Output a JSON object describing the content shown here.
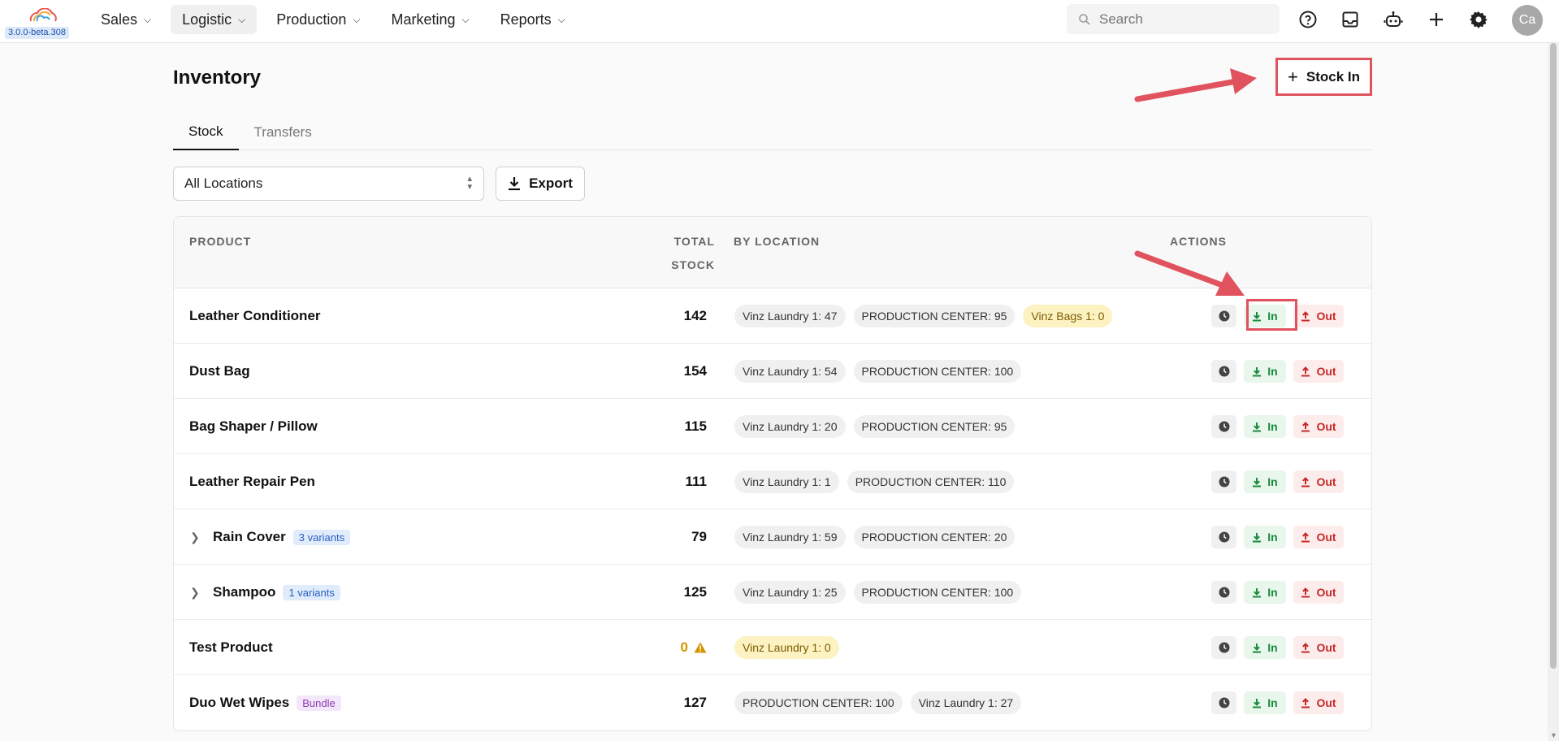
{
  "app": {
    "version": "3.0.0-beta.308",
    "avatar_initials": "Ca"
  },
  "nav": [
    {
      "label": "Sales",
      "active": false
    },
    {
      "label": "Logistic",
      "active": true
    },
    {
      "label": "Production",
      "active": false
    },
    {
      "label": "Marketing",
      "active": false
    },
    {
      "label": "Reports",
      "active": false
    }
  ],
  "search": {
    "placeholder": "Search"
  },
  "topbar_icons": [
    "help-icon",
    "inbox-icon",
    "robot-icon",
    "plus-icon",
    "gear-icon"
  ],
  "page": {
    "title": "Inventory",
    "stock_in_label": "Stock In"
  },
  "tabs": [
    {
      "label": "Stock",
      "active": true
    },
    {
      "label": "Transfers",
      "active": false
    }
  ],
  "filters": {
    "location_value": "All Locations",
    "export_label": "Export"
  },
  "table": {
    "headers": {
      "product": "PRODUCT",
      "total_line1": "TOTAL",
      "total_line2": "STOCK",
      "by_location": "BY LOCATION",
      "actions": "ACTIONS"
    },
    "action_labels": {
      "in": "In",
      "out": "Out"
    },
    "rows": [
      {
        "name": "Leather Conditioner",
        "total": "142",
        "locations": [
          "Vinz Laundry 1: 47",
          "PRODUCTION CENTER: 95",
          "Vinz Bags 1: 0"
        ]
      },
      {
        "name": "Dust Bag",
        "total": "154",
        "locations": [
          "Vinz Laundry 1: 54",
          "PRODUCTION CENTER: 100"
        ]
      },
      {
        "name": "Bag Shaper / Pillow",
        "total": "115",
        "locations": [
          "Vinz Laundry 1: 20",
          "PRODUCTION CENTER: 95"
        ]
      },
      {
        "name": "Leather Repair Pen",
        "total": "111",
        "locations": [
          "Vinz Laundry 1: 1",
          "PRODUCTION CENTER: 110"
        ]
      },
      {
        "name": "Rain Cover",
        "badge": "3 variants",
        "total": "79",
        "locations": [
          "Vinz Laundry 1: 59",
          "PRODUCTION CENTER: 20"
        ]
      },
      {
        "name": "Shampoo",
        "badge": "1 variants",
        "total": "125",
        "locations": [
          "Vinz Laundry 1: 25",
          "PRODUCTION CENTER: 100"
        ]
      },
      {
        "name": "Test Product",
        "total": "0",
        "locations": [
          "Vinz Laundry 1: 0"
        ]
      },
      {
        "name": "Duo Wet Wipes",
        "bundle": "Bundle",
        "total": "127",
        "locations": [
          "PRODUCTION CENTER: 100",
          "Vinz Laundry 1: 27"
        ]
      }
    ]
  },
  "colors": {
    "annotation_red": "#e0535e",
    "in_green": "#1a8a3d",
    "out_red": "#c62828",
    "warning_amber": "#d49400"
  }
}
